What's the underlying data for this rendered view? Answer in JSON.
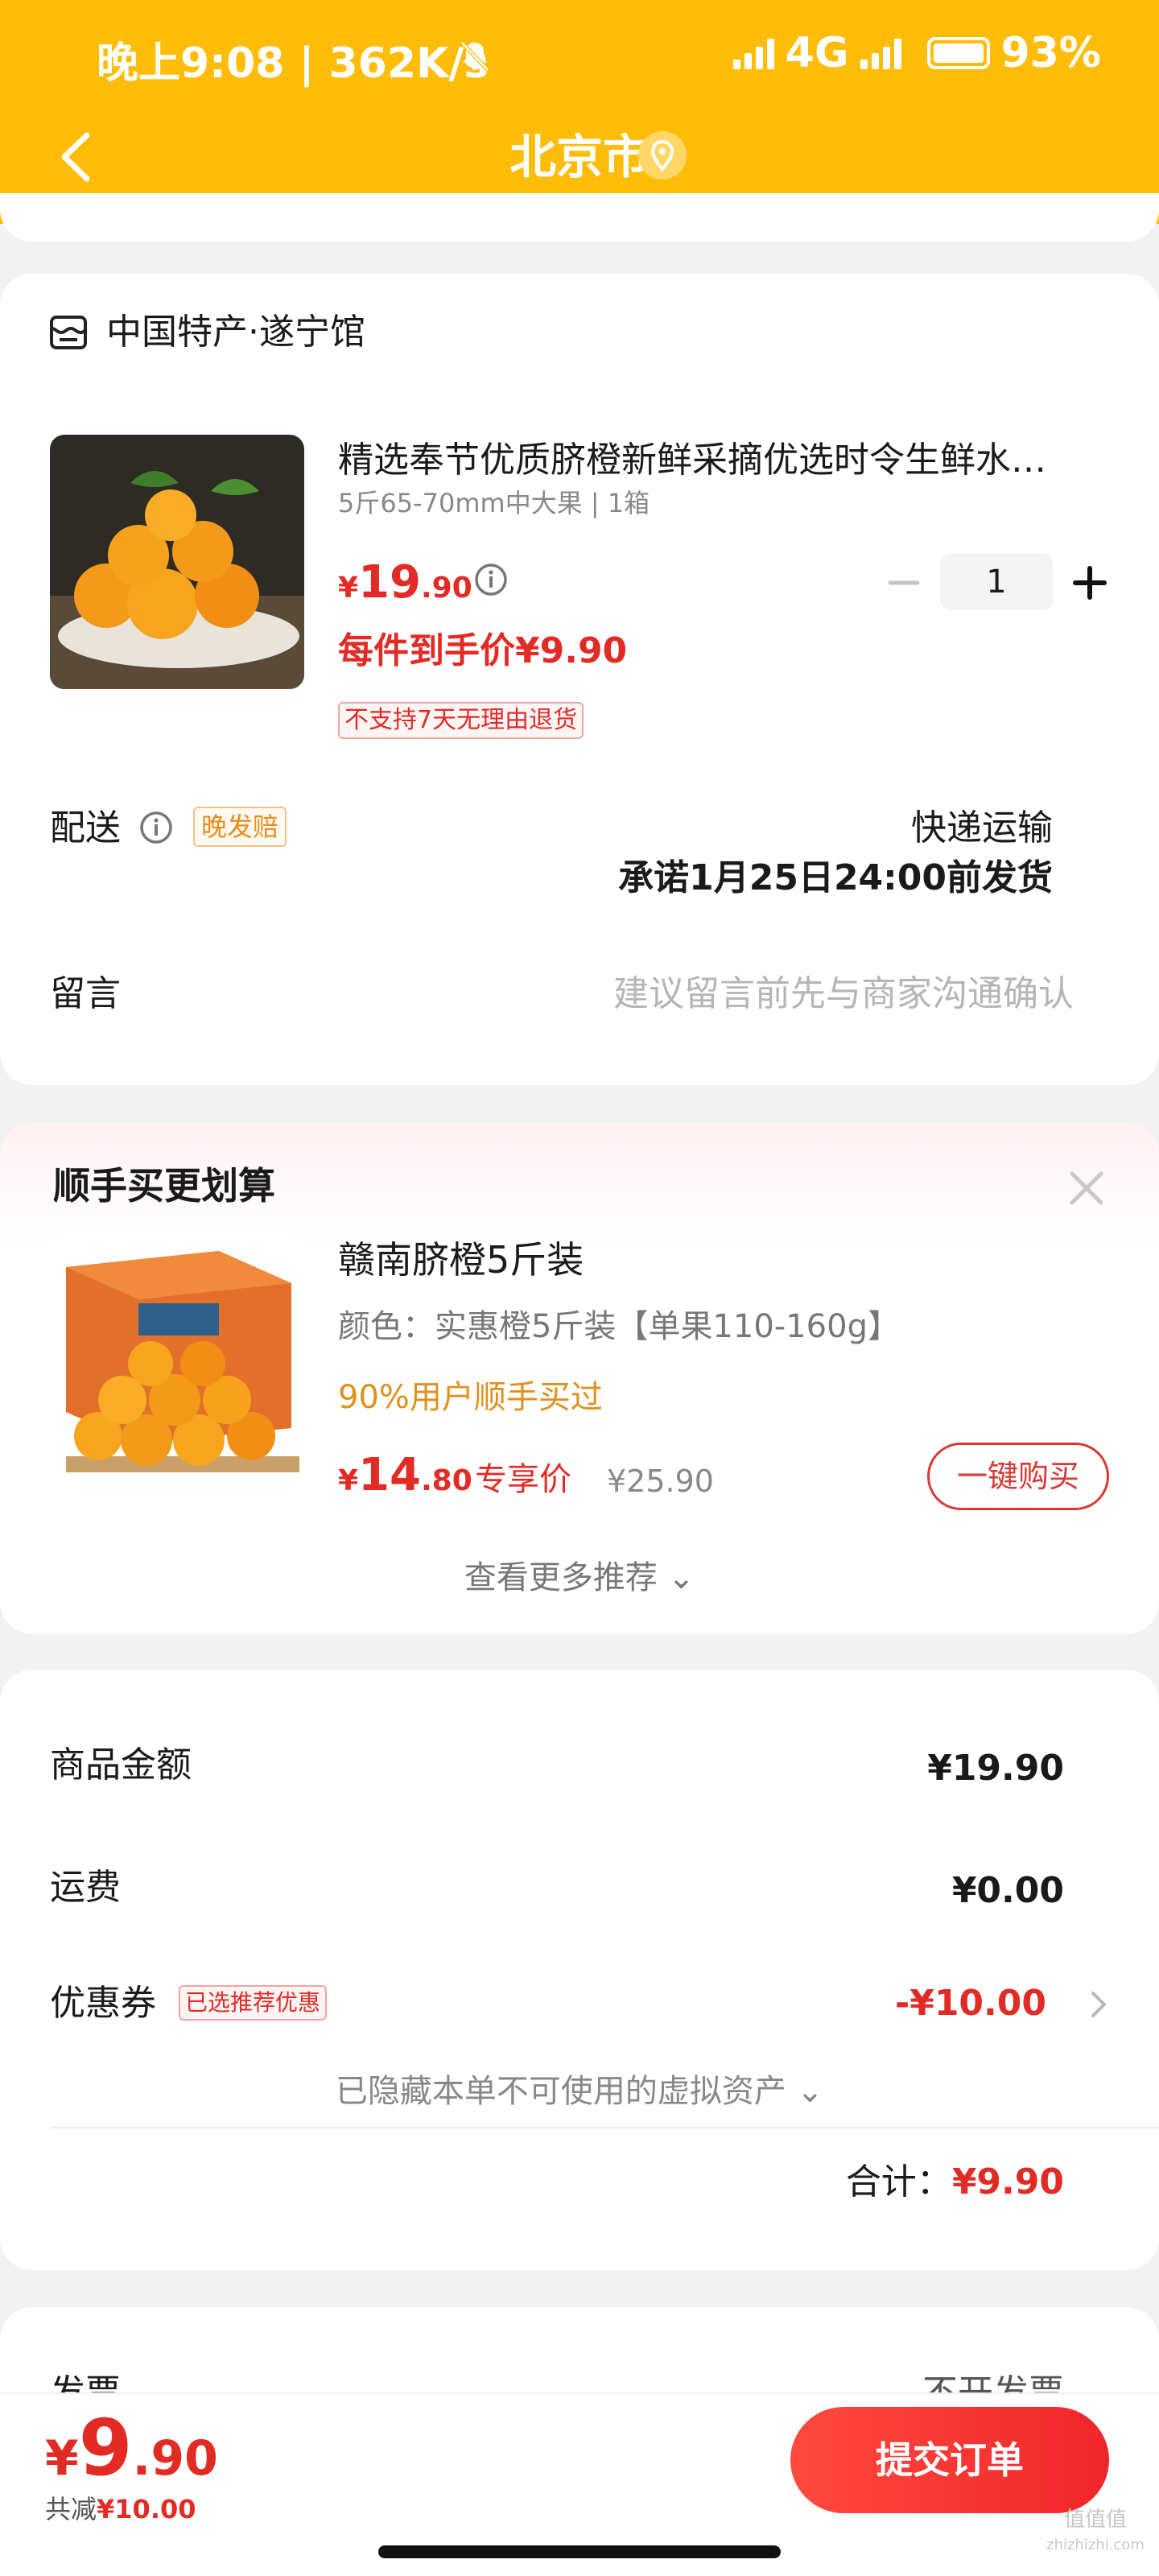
{
  "status_bar": {
    "time": "晚上9:08 | 362K/s",
    "network": "4G",
    "battery": "93%"
  },
  "nav": {
    "title": "北京市"
  },
  "order": {
    "store_name": "中国特产·遂宁馆",
    "product": {
      "title": "精选奉节优质脐橙新鲜采摘优选时令生鲜水…",
      "spec": "5斤65-70mm中大果 | 1箱",
      "price_currency": "¥",
      "price_int": "19",
      "price_dec": ".90",
      "quantity": "1",
      "unit_price_label": "每件到手价¥9.90",
      "return_policy_tag": "不支持7天无理由退货"
    },
    "delivery": {
      "label": "配送",
      "late_tag": "晚发赔",
      "method": "快递运输",
      "promise": "承诺1月25日24:00前发货"
    },
    "memo": {
      "label": "留言",
      "placeholder": "建议留言前先与商家沟通确认"
    }
  },
  "recommend": {
    "title": "顺手买更划算",
    "item": {
      "name": "赣南脐橙5斤装",
      "spec": "颜色：实惠橙5斤装【单果110-160g】",
      "popularity": "90%用户顺手买过",
      "price_currency": "¥",
      "price_int": "14",
      "price_dec": ".80",
      "exclusive_label": "专享价",
      "original_price": "¥25.90",
      "buy_button": "一键购买"
    },
    "more_label": "查看更多推荐"
  },
  "summary": {
    "goods_label": "商品金额",
    "goods_value": "¥19.90",
    "shipping_label": "运费",
    "shipping_value": "¥0.00",
    "coupon_label": "优惠券",
    "coupon_tag": "已选推荐优惠",
    "coupon_value": "-¥10.00",
    "hidden_assets": "已隐藏本单不可使用的虚拟资产",
    "total_label": "合计：",
    "total_value": "¥9.90"
  },
  "invoice": {
    "label": "发票",
    "value": "不开发票"
  },
  "bottom_bar": {
    "price_currency": "¥",
    "price_int": "9",
    "price_dec": ".90",
    "discount_prefix": "共减",
    "discount_value": "¥10.00",
    "submit_label": "提交订单"
  },
  "watermark": {
    "text": "值值值",
    "sub": "zhizhizhi.com"
  },
  "colors": {
    "header": "#ffbd0a",
    "price_red": "#e32b25",
    "orange_text": "#e0901c",
    "submit_gradient_start": "#ff4a3f",
    "submit_gradient_end": "#f0262a"
  }
}
